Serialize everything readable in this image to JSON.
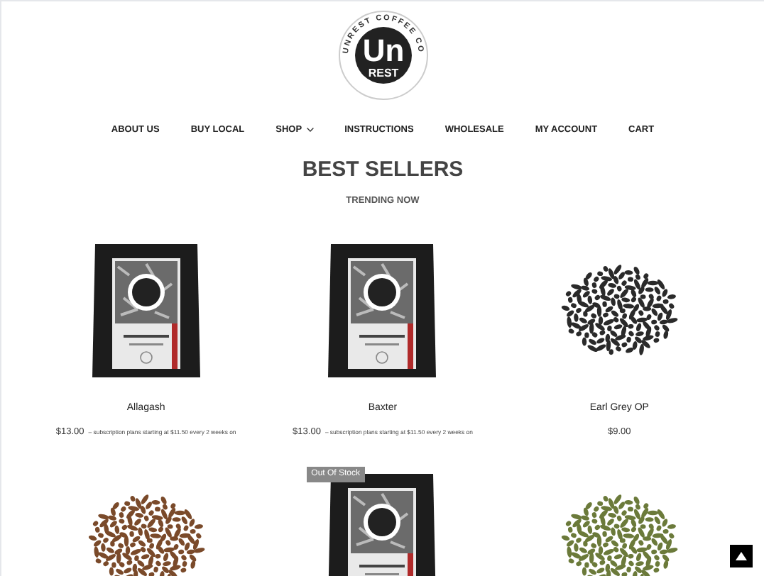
{
  "logo": {
    "arc_text": "UNREST COFFEE CO",
    "mark": "Un",
    "word": "REST"
  },
  "nav": [
    {
      "label": "ABOUT US",
      "dropdown": false
    },
    {
      "label": "BUY LOCAL",
      "dropdown": false
    },
    {
      "label": "SHOP",
      "dropdown": true
    },
    {
      "label": "INSTRUCTIONS",
      "dropdown": false
    },
    {
      "label": "WHOLESALE",
      "dropdown": false
    },
    {
      "label": "MY ACCOUNT",
      "dropdown": false
    },
    {
      "label": "CART",
      "dropdown": false
    }
  ],
  "heading": "BEST SELLERS",
  "subheading": "TRENDING NOW",
  "products": [
    {
      "kind": "bag",
      "name": "Allagash",
      "price": "$13.00",
      "note": "– subscription plans starting at $11.50 every 2 weeks on"
    },
    {
      "kind": "bag",
      "name": "Baxter",
      "price": "$13.00",
      "note": "– subscription plans starting at $11.50 every 2 weeks on"
    },
    {
      "kind": "tea",
      "name": "Earl Grey OP",
      "price": "$9.00"
    },
    {
      "kind": "ground"
    },
    {
      "kind": "bag",
      "badge": "Out Of Stock"
    },
    {
      "kind": "herb"
    }
  ]
}
